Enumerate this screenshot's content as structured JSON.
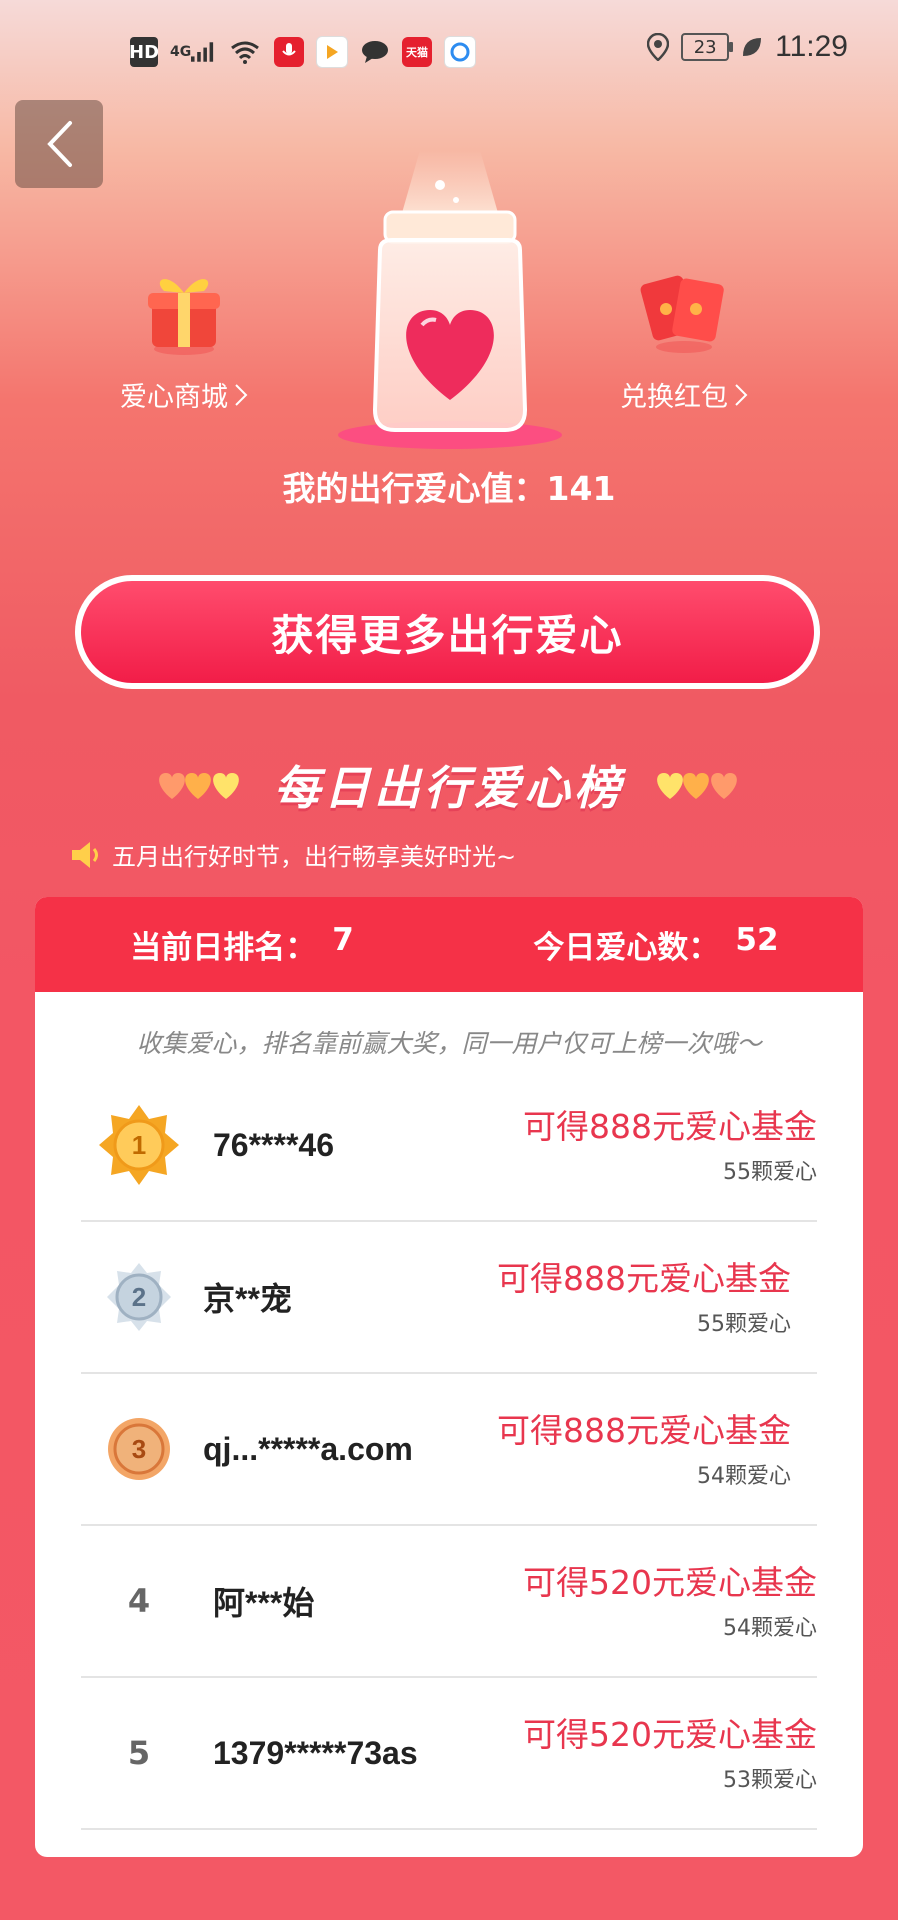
{
  "status_bar": {
    "left_icons": [
      "HD",
      "4G",
      "wifi-icon",
      "mic-app-icon",
      "video-app-icon",
      "chat-icon",
      "tmall-icon",
      "browser-icon"
    ],
    "battery": "23",
    "time": "11:29"
  },
  "header": {
    "mall_label": "爱心商城",
    "redeem_label": "兑换红包",
    "love_value": "我的出行爱心值：141"
  },
  "cta": {
    "label": "获得更多出行爱心"
  },
  "board": {
    "title": "每日出行爱心榜",
    "notice": "五月出行好时节，出行畅享美好时光~",
    "rank_label": "当前日排名：",
    "rank_value": "7",
    "today_label": "今日爱心数：",
    "today_value": "52",
    "tip": "收集爱心，排名靠前赢大奖，同一用户仅可上榜一次哦～",
    "rows": [
      {
        "rank": "1",
        "name": "76****46",
        "reward": "可得888元爱心基金",
        "hearts": "55颗爱心"
      },
      {
        "rank": "2",
        "name": "京**宠",
        "reward": "可得888元爱心基金",
        "hearts": "55颗爱心"
      },
      {
        "rank": "3",
        "name": "qj...*****a.com",
        "reward": "可得888元爱心基金",
        "hearts": "54颗爱心"
      },
      {
        "rank": "4",
        "name": "阿***始",
        "reward": "可得520元爱心基金",
        "hearts": "54颗爱心"
      },
      {
        "rank": "5",
        "name": "1379*****73as",
        "reward": "可得520元爱心基金",
        "hearts": "53颗爱心"
      }
    ]
  },
  "colors": {
    "accent_red": "#f53147",
    "reward_red": "#e8364e",
    "gold": "#f5a623",
    "silver": "#a9b8c6",
    "bronze": "#e0843f"
  }
}
